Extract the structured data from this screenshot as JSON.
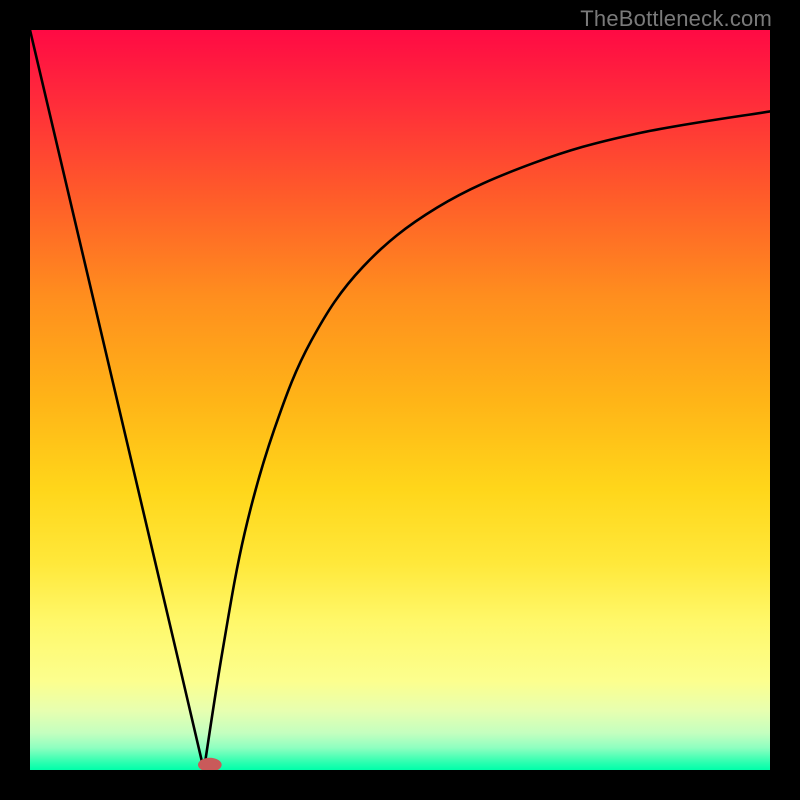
{
  "attribution": "TheBottleneck.com",
  "chart_data": {
    "type": "line",
    "title": "",
    "xlabel": "",
    "ylabel": "",
    "xlim": [
      0,
      100
    ],
    "ylim": [
      0,
      100
    ],
    "gradient_stops": [
      {
        "pos": 0,
        "color": "#ff0a44"
      },
      {
        "pos": 10,
        "color": "#ff2d3a"
      },
      {
        "pos": 22,
        "color": "#ff5a2a"
      },
      {
        "pos": 36,
        "color": "#ff8e1e"
      },
      {
        "pos": 50,
        "color": "#ffb417"
      },
      {
        "pos": 62,
        "color": "#ffd61a"
      },
      {
        "pos": 72,
        "color": "#ffe83a"
      },
      {
        "pos": 80,
        "color": "#fff86a"
      },
      {
        "pos": 88,
        "color": "#fcff8e"
      },
      {
        "pos": 92,
        "color": "#e7ffb0"
      },
      {
        "pos": 95,
        "color": "#c4ffbf"
      },
      {
        "pos": 97,
        "color": "#8effc0"
      },
      {
        "pos": 99,
        "color": "#2affb0"
      },
      {
        "pos": 100,
        "color": "#00ffaa"
      }
    ],
    "series": [
      {
        "name": "left-branch",
        "x": [
          0,
          4,
          8,
          12,
          16,
          20,
          23.5
        ],
        "y": [
          100,
          83,
          66,
          49,
          32,
          15,
          0
        ]
      },
      {
        "name": "right-branch",
        "x": [
          23.5,
          26,
          29,
          33,
          38,
          45,
          55,
          68,
          82,
          100
        ],
        "y": [
          0,
          16,
          32,
          46,
          58,
          68,
          76,
          82,
          86,
          89
        ]
      }
    ],
    "marker": {
      "name": "valley-marker",
      "x": 24.3,
      "y": 0.7,
      "rx": 1.6,
      "ry": 0.95,
      "color": "#c95a5a"
    }
  }
}
